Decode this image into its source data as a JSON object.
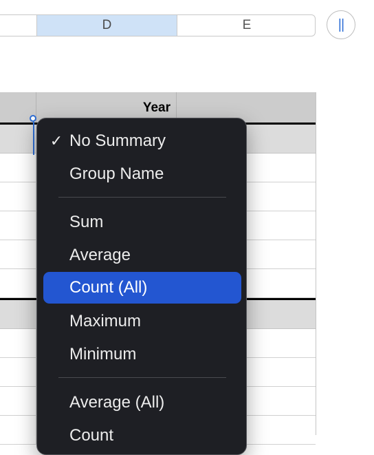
{
  "columns": {
    "c": "",
    "d": "D",
    "e": "E"
  },
  "sidebar_toggle_glyph": "||",
  "table": {
    "header_year": "Year"
  },
  "menu": {
    "items": [
      {
        "label": "No Summary",
        "checked": true,
        "check_mark": "✓"
      },
      {
        "label": "Group Name"
      },
      {
        "label": "Sum"
      },
      {
        "label": "Average"
      },
      {
        "label": "Count (All)",
        "highlighted": true
      },
      {
        "label": "Maximum"
      },
      {
        "label": "Minimum"
      },
      {
        "label": "Average (All)"
      },
      {
        "label": "Count"
      }
    ]
  },
  "colors": {
    "accent": "#2356d1",
    "selected_column": "#cfe2f7",
    "menu_bg": "#1e1f24"
  }
}
